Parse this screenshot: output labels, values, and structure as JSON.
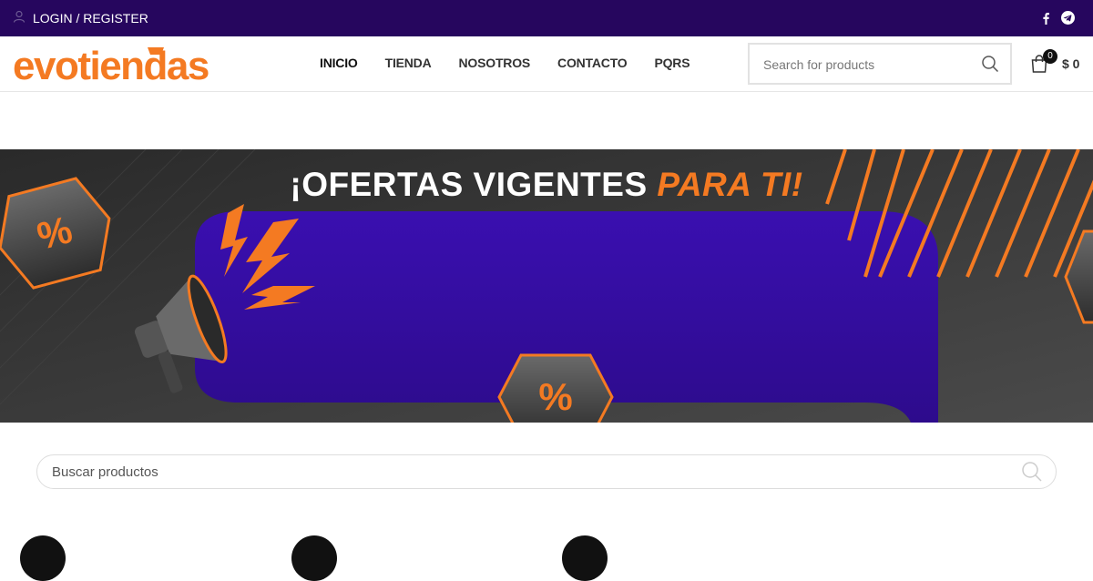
{
  "topbar": {
    "login_label": "LOGIN / REGISTER",
    "social": [
      "facebook-icon",
      "telegram-icon"
    ]
  },
  "header": {
    "logo_text": "evotiendas",
    "nav": [
      {
        "label": "INICIO"
      },
      {
        "label": "TIENDA"
      },
      {
        "label": "NOSOTROS"
      },
      {
        "label": "CONTACTO"
      },
      {
        "label": "PQRS"
      }
    ],
    "search_placeholder": "Search for products",
    "cart_count": "0",
    "cart_total": "$ 0"
  },
  "banner": {
    "title_main": "¡OFERTAS VIGENTES",
    "title_accent": "PARA TI!"
  },
  "product_search": {
    "placeholder": "Buscar productos"
  },
  "colors": {
    "topbar": "#26065e",
    "accent": "#f47a22",
    "banner_purple": "#3a0fa3"
  }
}
